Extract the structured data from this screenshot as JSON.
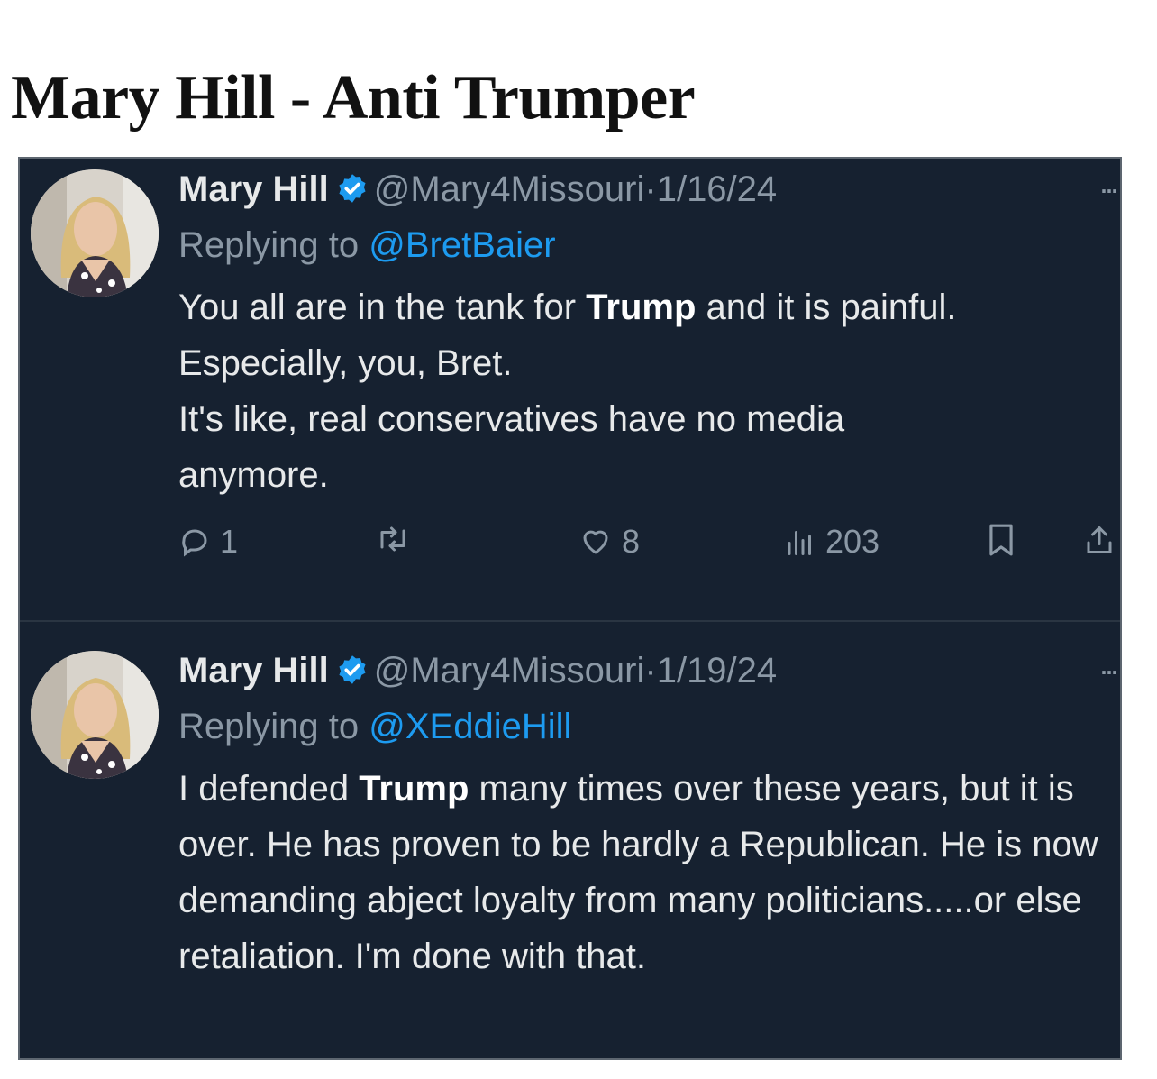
{
  "page_title": "Mary Hill - Anti Trumper",
  "colors": {
    "panel_bg": "#162130",
    "link": "#1d9bf0",
    "muted": "#8b98a5",
    "text": "#e7e9ea"
  },
  "tweets": [
    {
      "name": "Mary Hill",
      "handle": "@Mary4Missouri",
      "separator": "·",
      "date": "1/16/24",
      "replying_label": "Replying to",
      "reply_to": "@BretBaier",
      "body_parts": [
        "You all are in the tank for ",
        "Trump",
        " and it is painful."
      ],
      "body_lines": [
        "Especially, you, Bret.",
        "It's like, real conservatives have no media anymore."
      ],
      "stats": {
        "replies": "1",
        "likes": "8",
        "views": "203"
      },
      "icons": [
        "reply-icon",
        "retweet-icon",
        "like-icon",
        "views-icon",
        "bookmark-icon",
        "share-icon"
      ]
    },
    {
      "name": "Mary Hill",
      "handle": "@Mary4Missouri",
      "separator": "·",
      "date": "1/19/24",
      "replying_label": "Replying to",
      "reply_to": "@XEddieHill",
      "body_parts": [
        "I defended ",
        "Trump",
        " many times over these years, but it is over. He has proven to be hardly a Republican. He is now demanding abject loyalty from many politicians.....or else retaliation. I'm done with that."
      ]
    }
  ]
}
